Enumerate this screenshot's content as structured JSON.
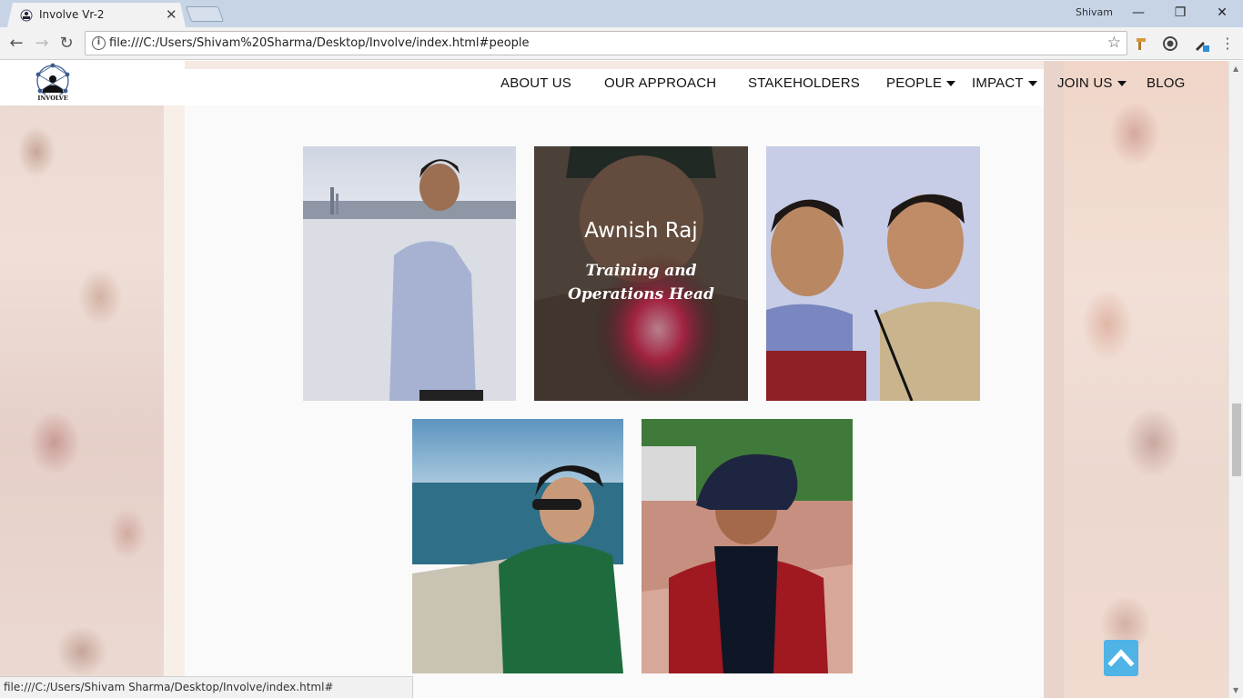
{
  "browser": {
    "tab_title": "Involve Vr-2",
    "tab_close": "✕",
    "profile": "Shivam",
    "url": "file:///C:/Users/Shivam%20Sharma/Desktop/Involve/index.html#people",
    "status_url": "file:///C:/Users/Shivam Sharma/Desktop/Involve/index.html#",
    "window_controls": [
      "—",
      "❐",
      "✕"
    ]
  },
  "site": {
    "logo_text": "INVOLVE",
    "nav": [
      {
        "label": "ABOUT US",
        "dropdown": false
      },
      {
        "label": "OUR APPROACH",
        "dropdown": false
      },
      {
        "label": "STAKEHOLDERS",
        "dropdown": false
      },
      {
        "label": "PEOPLE",
        "dropdown": true
      },
      {
        "label": "IMPACT",
        "dropdown": true
      },
      {
        "label": "JOIN US",
        "dropdown": true
      },
      {
        "label": "BLOG",
        "dropdown": false
      }
    ]
  },
  "people": {
    "hovered": {
      "name": "Awnish Raj",
      "role": "Training and Operations Head"
    }
  },
  "colors": {
    "accent": "#4fb3e6"
  }
}
